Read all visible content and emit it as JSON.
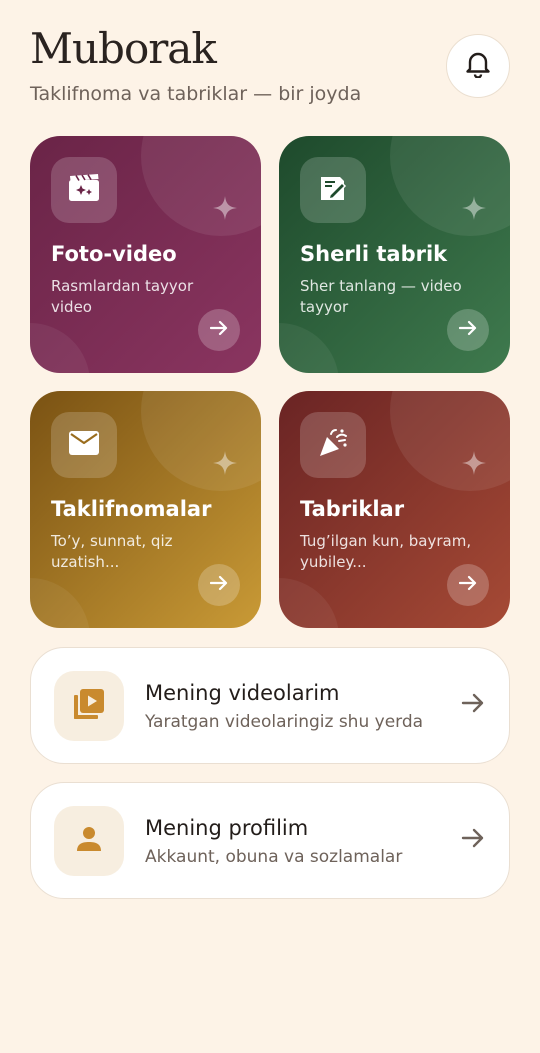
{
  "header": {
    "title": "Muborak",
    "subtitle": "Taklifnoma va tabriklar — bir joyda",
    "bell_icon": "bell-icon"
  },
  "cards": [
    {
      "title": "Foto-video",
      "description": "Rasmlardan tayyor video",
      "icon": "movie-sparkle-icon",
      "color_from": "#6a2447",
      "color_to": "#8a3560"
    },
    {
      "title": "Sherli tabrik",
      "description": "Sher tanlang — video tayyor",
      "icon": "edit-document-icon",
      "color_from": "#1e4a2c",
      "color_to": "#3f7a4e"
    },
    {
      "title": "Taklifnomalar",
      "description": "To’y, sunnat, qiz uzatish...",
      "icon": "envelope-icon",
      "color_from": "#7a5213",
      "color_to": "#c99a36"
    },
    {
      "title": "Tabriklar",
      "description": "Tug’ilgan kun, bayram, yubiley...",
      "icon": "party-popper-icon",
      "color_from": "#6a2424",
      "color_to": "#a64a35"
    }
  ],
  "list": [
    {
      "title": "Mening videolarim",
      "description": "Yaratgan videolaringiz shu yerda",
      "icon": "video-library-icon"
    },
    {
      "title": "Mening profilim",
      "description": "Akkaunt, obuna va sozlamalar",
      "icon": "person-icon"
    }
  ],
  "colors": {
    "background": "#fdf3e7",
    "accent": "#c98a2e",
    "text": "#2a2320",
    "muted": "#6e625a"
  }
}
